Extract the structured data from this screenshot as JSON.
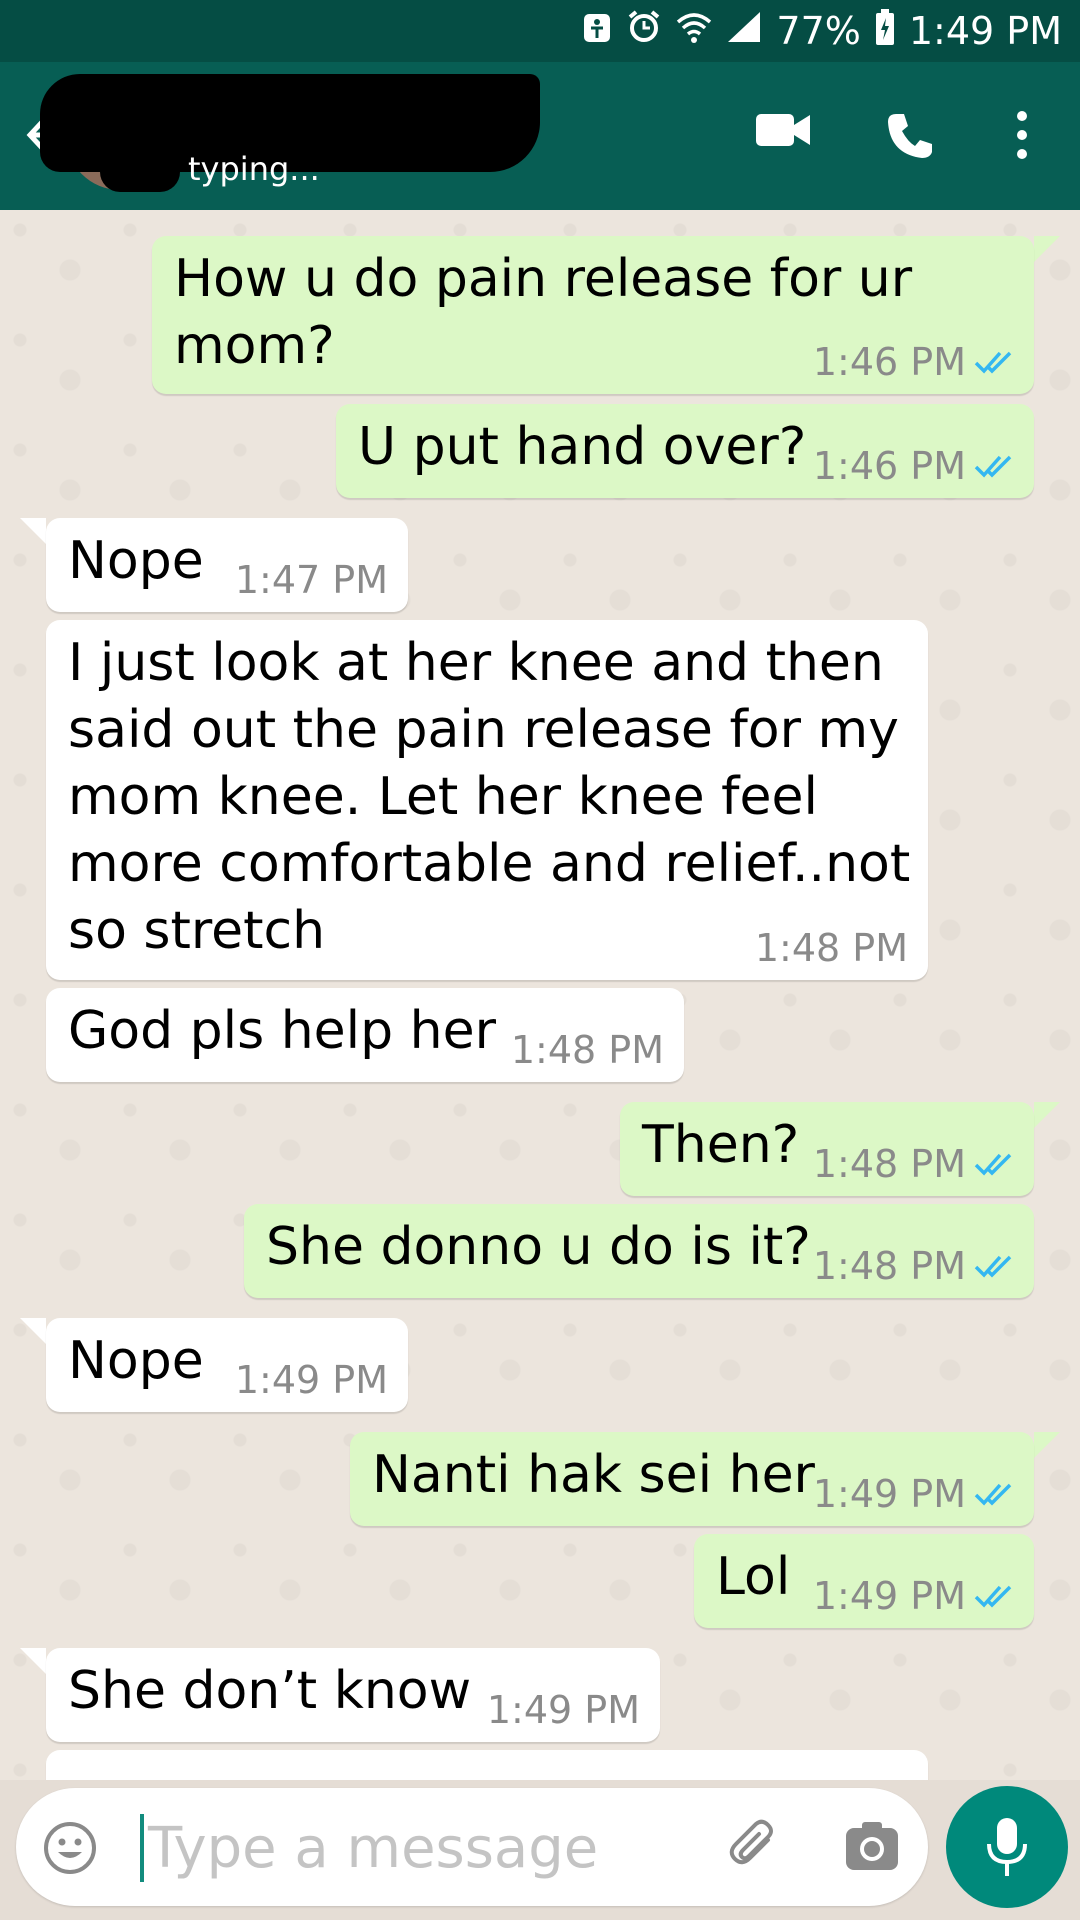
{
  "status_bar": {
    "battery": "77%",
    "time": "1:49 PM",
    "icons": [
      "accessibility-icon",
      "alarm-icon",
      "wifi-icon",
      "signal-icon",
      "battery-icon"
    ]
  },
  "header": {
    "status": "typing...",
    "icons": [
      "back-arrow-icon",
      "video-call-icon",
      "phone-icon",
      "more-options-icon"
    ]
  },
  "messages": [
    {
      "dir": "out",
      "text": "How u do pain release for ur\nmom?",
      "time": "1:46 PM",
      "read": true
    },
    {
      "dir": "out",
      "text": "U put hand over?",
      "time": "1:46 PM",
      "read": true
    },
    {
      "dir": "in",
      "text": "Nope",
      "time": "1:47 PM"
    },
    {
      "dir": "in",
      "text": "I just look at her knee and then\nsaid out the pain release for my\nmom knee. Let her knee feel\nmore comfortable and relief..not\nso stretch",
      "time": "1:48 PM"
    },
    {
      "dir": "in",
      "text": "God pls help her",
      "time": "1:48 PM"
    },
    {
      "dir": "out",
      "text": "Then?",
      "time": "1:48 PM",
      "read": true
    },
    {
      "dir": "out",
      "text": "She donno u do is it?",
      "time": "1:48 PM",
      "read": true
    },
    {
      "dir": "in",
      "text": "Nope",
      "time": "1:49 PM"
    },
    {
      "dir": "out",
      "text": "Nanti hak sei her",
      "time": "1:49 PM",
      "read": true
    },
    {
      "dir": "out",
      "text": "Lol",
      "time": "1:49 PM",
      "read": true
    },
    {
      "dir": "in",
      "text": "She don’t know",
      "time": "1:49 PM"
    }
  ],
  "input": {
    "placeholder": "Type a message",
    "icons": [
      "emoji-icon",
      "attach-icon",
      "camera-icon",
      "mic-icon"
    ]
  },
  "colors": {
    "header": "#075e54",
    "status_bar": "#054d44",
    "outgoing_bubble": "#dcf8c6",
    "incoming_bubble": "#ffffff",
    "read_ticks": "#34b7f1",
    "mic_button": "#00897b"
  }
}
